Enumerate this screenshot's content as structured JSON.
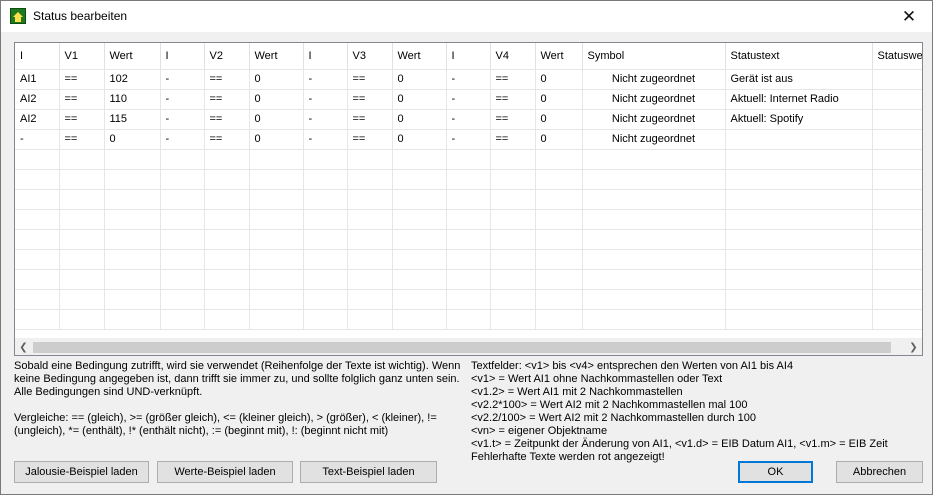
{
  "window": {
    "title": "Status bearbeiten",
    "close_glyph": "✕"
  },
  "grid": {
    "columns": [
      "I",
      "V1",
      "Wert",
      "I",
      "V2",
      "Wert",
      "I",
      "V3",
      "Wert",
      "I",
      "V4",
      "Wert",
      "Symbol",
      "Statustext",
      "Statuswe"
    ],
    "rows": [
      [
        "AI1",
        "==",
        "102",
        "-",
        "==",
        "0",
        "-",
        "==",
        "0",
        "-",
        "==",
        "0",
        "Nicht zugeordnet",
        "Gerät ist aus",
        ""
      ],
      [
        "AI2",
        "==",
        "110",
        "-",
        "==",
        "0",
        "-",
        "==",
        "0",
        "-",
        "==",
        "0",
        "Nicht zugeordnet",
        "Aktuell: Internet Radio",
        ""
      ],
      [
        "AI2",
        "==",
        "115",
        "-",
        "==",
        "0",
        "-",
        "==",
        "0",
        "-",
        "==",
        "0",
        "Nicht zugeordnet",
        "Aktuell: Spotify",
        ""
      ],
      [
        "-",
        "==",
        "0",
        "-",
        "==",
        "0",
        "-",
        "==",
        "0",
        "-",
        "==",
        "0",
        "Nicht zugeordnet",
        "",
        ""
      ]
    ],
    "empty_rows": 9,
    "scroll_left": "❮",
    "scroll_right": "❯"
  },
  "help_left": {
    "para1": "Sobald eine Bedingung zutrifft, wird sie verwendet (Reihenfolge der Texte ist wichtig). Wenn keine Bedingung angegeben ist, dann trifft sie immer zu, und sollte folglich ganz unten sein. Alle Bedingungen sind UND-verknüpft.",
    "para2": "Vergleiche: == (gleich), >= (größer gleich), <= (kleiner gleich), > (größer), < (kleiner), != (ungleich), *= (enthält), !* (enthält nicht), := (beginnt mit), !: (beginnt nicht mit)"
  },
  "help_right": {
    "lines": [
      "Textfelder: <v1> bis <v4> entsprechen den Werten von AI1 bis AI4",
      "<v1> = Wert AI1 ohne Nachkommastellen oder Text",
      "<v1.2> = Wert AI1 mit 2 Nachkommastellen",
      "<v2.2*100> = Wert AI2 mit 2 Nachkommastellen mal 100",
      "<v2.2/100> = Wert AI2 mit 2 Nachkommastellen durch 100",
      "<vn> = eigener Objektname",
      "<v1.t> = Zeitpunkt der Änderung von AI1, <v1.d> = EIB Datum AI1, <v1.m> = EIB Zeit",
      "Fehlerhafte Texte werden rot angezeigt!"
    ]
  },
  "buttons": {
    "jalousie": "Jalousie-Beispiel laden",
    "werte": "Werte-Beispiel laden",
    "text": "Text-Beispiel laden",
    "ok": "OK",
    "cancel": "Abbrechen"
  }
}
